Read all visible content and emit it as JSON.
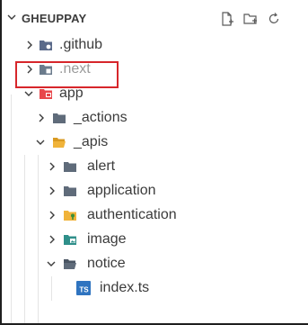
{
  "explorer": {
    "root_label": "GHEUPPAY",
    "actions": [
      {
        "name": "new-file-icon"
      },
      {
        "name": "new-folder-icon"
      },
      {
        "name": "refresh-icon"
      }
    ]
  },
  "tree": [
    {
      "label": ".github",
      "depth": 1,
      "expanded": false,
      "icon": "folder-github-icon",
      "color": "#5a6a8a"
    },
    {
      "label": ".next",
      "depth": 1,
      "expanded": false,
      "icon": "folder-next-icon",
      "color": "#6b7b8c",
      "dim": true
    },
    {
      "label": "app",
      "depth": 1,
      "expanded": true,
      "icon": "folder-app-icon",
      "color": "#e8474b"
    },
    {
      "label": "_actions",
      "depth": 2,
      "expanded": false,
      "icon": "folder-icon",
      "color": "#5f6b7a"
    },
    {
      "label": "_apis",
      "depth": 2,
      "expanded": true,
      "icon": "folder-open-icon",
      "color": "#f0b33a"
    },
    {
      "label": "alert",
      "depth": 3,
      "expanded": false,
      "icon": "folder-icon",
      "color": "#5f6b7a"
    },
    {
      "label": "application",
      "depth": 3,
      "expanded": false,
      "icon": "folder-icon",
      "color": "#5f6b7a"
    },
    {
      "label": "authentication",
      "depth": 3,
      "expanded": false,
      "icon": "folder-auth-icon",
      "color": "#f0b33a"
    },
    {
      "label": "image",
      "depth": 3,
      "expanded": false,
      "icon": "folder-image-icon",
      "color": "#2f8f8a"
    },
    {
      "label": "notice",
      "depth": 3,
      "expanded": true,
      "icon": "folder-open-icon",
      "color": "#5f6b7a"
    },
    {
      "label": "index.ts",
      "depth": 4,
      "file": true,
      "icon": "typescript-file-icon",
      "icon_text": "TS",
      "color": "#2f74c0"
    }
  ],
  "highlight_color": "#d7262b"
}
